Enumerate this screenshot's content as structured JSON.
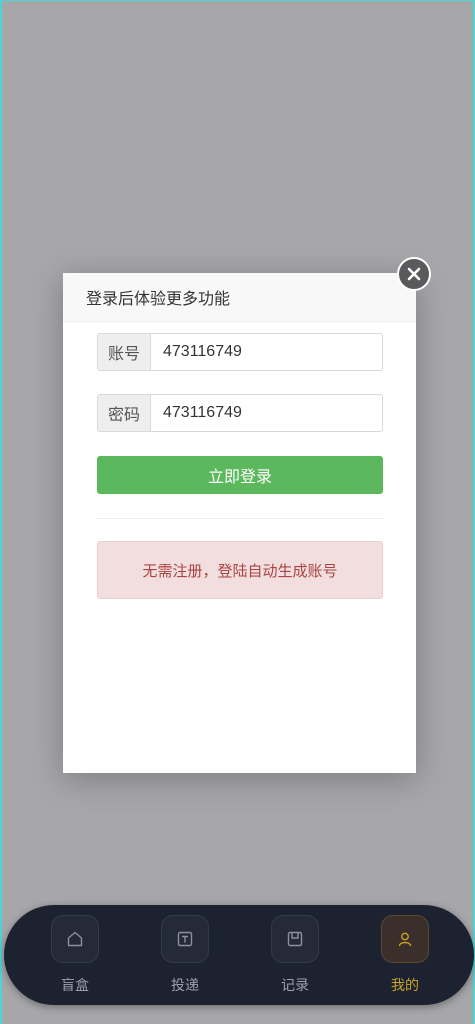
{
  "modal": {
    "title": "登录后体验更多功能",
    "account_label": "账号",
    "account_value": "473116749",
    "password_label": "密码",
    "password_value": "473116749",
    "login_button": "立即登录",
    "notice": "无需注册，登陆自动生成账号"
  },
  "nav": {
    "items": [
      {
        "label": "盲盒",
        "icon": "home-icon"
      },
      {
        "label": "投递",
        "icon": "deliver-icon"
      },
      {
        "label": "记录",
        "icon": "record-icon"
      },
      {
        "label": "我的",
        "icon": "user-icon",
        "active": true
      }
    ]
  },
  "colors": {
    "primary_green": "#5cb85c",
    "alert_bg": "#f2dede",
    "alert_text": "#a94442",
    "nav_bg": "#1d2231",
    "nav_active": "#c9a227"
  }
}
